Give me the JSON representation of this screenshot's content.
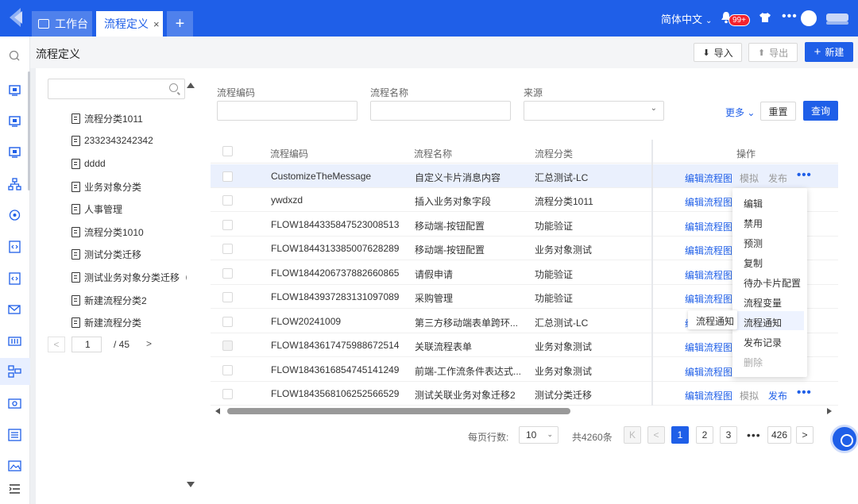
{
  "header": {
    "tabs": [
      {
        "label": "工作台"
      },
      {
        "label": "流程定义",
        "close": "×"
      },
      {
        "label": "+"
      }
    ],
    "language": "简体中文",
    "notification_count": "99+"
  },
  "page": {
    "title": "流程定义",
    "import_label": "导入",
    "export_label": "导出",
    "new_label": "新建"
  },
  "tree": {
    "items": [
      "流程分类1011",
      "2332343242342",
      "dddd",
      "业务对象分类",
      "人事管理",
      "流程分类1010",
      "测试分类迁移",
      "测试业务对象分类迁移（预",
      "新建流程分类2",
      "新建流程分类"
    ],
    "pager": {
      "current": "1",
      "total": "/ 45",
      "prev": "<",
      "next": ">"
    }
  },
  "filters": {
    "code_label": "流程编码",
    "name_label": "流程名称",
    "source_label": "来源",
    "more_label": "更多",
    "reset_label": "重置",
    "query_label": "查询"
  },
  "table": {
    "headers": {
      "code": "流程编码",
      "name": "流程名称",
      "category": "流程分类",
      "ops": "操作"
    },
    "rows": [
      {
        "code": "CustomizeTheMessage",
        "name": "自定义卡片消息内容",
        "category": "汇总测试-LC"
      },
      {
        "code": "ywdxzd",
        "name": "插入业务对象字段",
        "category": "流程分类1011"
      },
      {
        "code": "FLOW1844335847523008513",
        "name": "移动端-按钮配置",
        "category": "功能验证"
      },
      {
        "code": "FLOW1844313385007628289",
        "name": "移动端-按钮配置",
        "category": "业务对象测试"
      },
      {
        "code": "FLOW1844206737882660865",
        "name": "请假申请",
        "category": "功能验证"
      },
      {
        "code": "FLOW1843937283131097089",
        "name": "采购管理",
        "category": "功能验证"
      },
      {
        "code": "FLOW20241009",
        "name": "第三方移动端表单跨环...",
        "category": "汇总测试-LC"
      },
      {
        "code": "FLOW1843617475988672514",
        "name": "关联流程表单",
        "category": "业务对象测试"
      },
      {
        "code": "FLOW1843616854745141249",
        "name": "前端-工作流条件表达式...",
        "category": "业务对象测试"
      },
      {
        "code": "FLOW1843568106252566529",
        "name": "测试关联业务对象迁移2",
        "category": "测试分类迁移"
      }
    ],
    "op_edit": "编辑流程图",
    "op_simulate": "模拟",
    "op_publish": "发布",
    "op_edit_partial": "编"
  },
  "menu": {
    "items": [
      "编辑",
      "禁用",
      "预测",
      "复制",
      "待办卡片配置",
      "流程变量",
      "流程通知",
      "发布记录",
      "删除"
    ],
    "tooltip": "流程通知"
  },
  "pagination": {
    "page_size_label": "每页行数:",
    "page_size": "10",
    "total": "共4260条",
    "pages": [
      "1",
      "2",
      "3"
    ],
    "last_page": "426",
    "first": "K",
    "prev": "<",
    "next": ">",
    "ellipsis": "•••"
  },
  "colors": {
    "primary": "#1f5fe8",
    "badge": "#f5222d"
  }
}
